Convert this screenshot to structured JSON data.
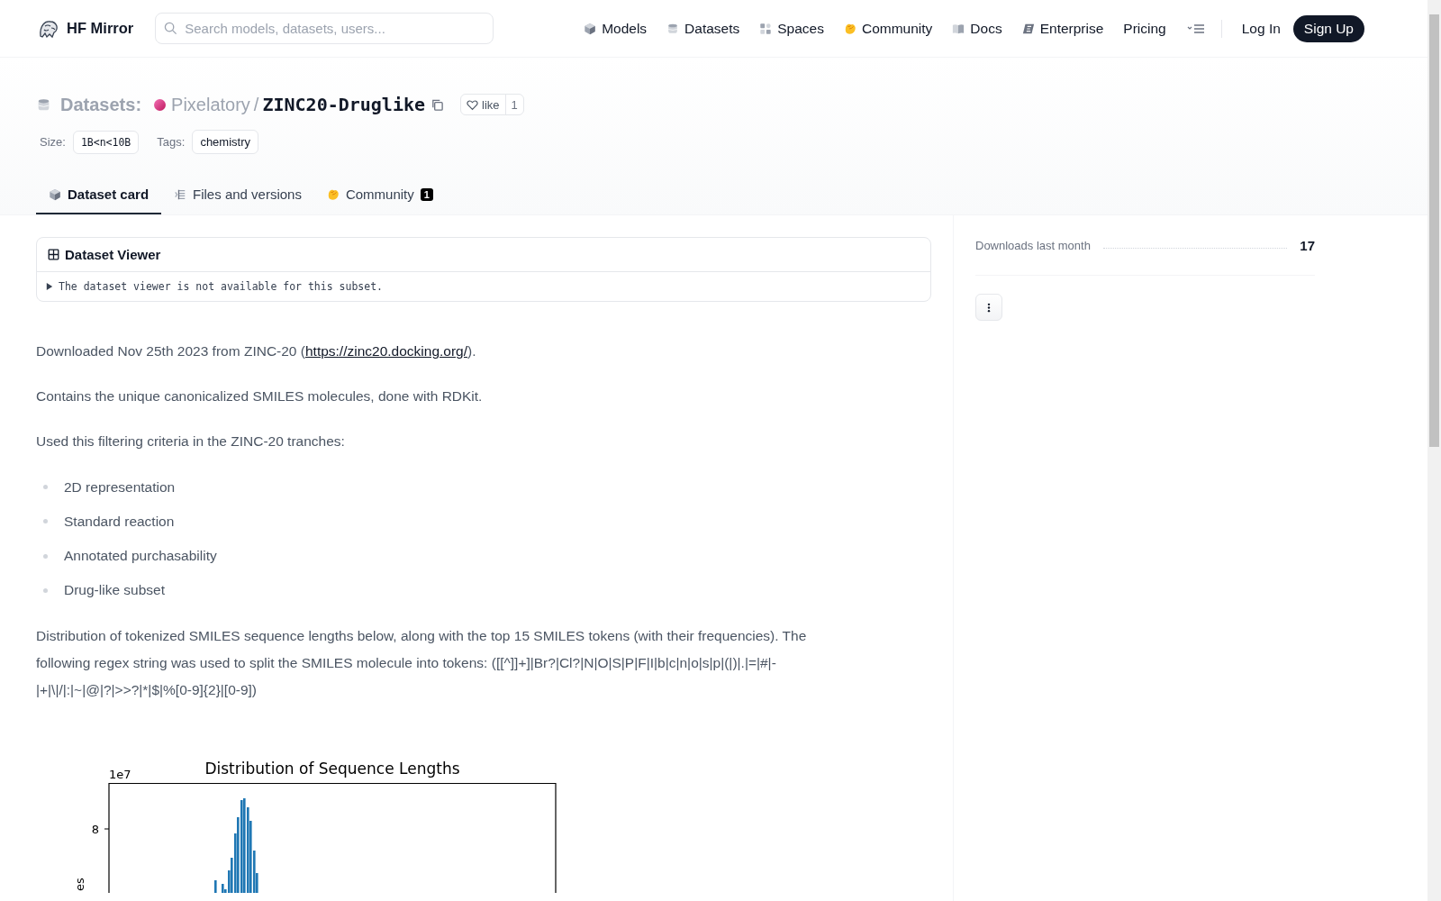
{
  "header": {
    "brand": "HF Mirror",
    "search": {
      "placeholder": "Search models, datasets, users..."
    },
    "nav": [
      {
        "label": "Models"
      },
      {
        "label": "Datasets"
      },
      {
        "label": "Spaces"
      },
      {
        "label": "Community"
      },
      {
        "label": "Docs"
      },
      {
        "label": "Enterprise"
      },
      {
        "label": "Pricing"
      }
    ],
    "login": "Log In",
    "signup": "Sign Up"
  },
  "repo": {
    "type_label": "Datasets:",
    "owner": "Pixelatory",
    "separator": "/",
    "name": "ZINC20-Druglike",
    "like": {
      "label": "like",
      "count": "1"
    },
    "size": {
      "label": "Size:",
      "value": "1B<n<10B"
    },
    "tags": {
      "label": "Tags:",
      "values": [
        "chemistry"
      ]
    }
  },
  "tabs": [
    {
      "label": "Dataset card",
      "selected": true
    },
    {
      "label": "Files and versions",
      "selected": false
    },
    {
      "label": "Community",
      "badge": "1",
      "selected": false
    }
  ],
  "viewer": {
    "title": "Dataset Viewer",
    "message": "The dataset viewer is not available for this subset."
  },
  "card": {
    "blocks": [
      {
        "kind": "paragraph",
        "parts": [
          {
            "kind": "text",
            "text": "Downloaded Nov 25th 2023 from ZINC-20 ("
          },
          {
            "kind": "link",
            "text": "https://zinc20.docking.org/"
          },
          {
            "kind": "text",
            "text": ")."
          }
        ]
      },
      {
        "kind": "paragraph",
        "parts": [
          {
            "kind": "text",
            "text": "Contains the unique canonicalized SMILES molecules, done with RDKit."
          }
        ]
      },
      {
        "kind": "paragraph",
        "parts": [
          {
            "kind": "text",
            "text": "Used this filtering criteria in the ZINC-20 tranches:"
          }
        ]
      },
      {
        "kind": "list",
        "items": [
          "2D representation",
          "Standard reaction",
          "Annotated purchasability",
          "Drug-like subset"
        ]
      },
      {
        "kind": "paragraph",
        "parts": [
          {
            "kind": "text",
            "text": "Distribution of tokenized SMILES sequence lengths below, along with the top 15 SMILES tokens (with their frequencies). The following regex string was used to split the SMILES molecule into tokens: ([[^]]+]|Br?|Cl?|N|O|S|P|F|I|b|c|n|o|s|p|(|)|.|=|#|-|+|\\|/|:|~|@|?|>>?|*|$|%[0-9]{2}|[0-9])"
          }
        ]
      }
    ],
    "chart": {
      "title": "Distribution of Sequence Lengths",
      "offset_label": "1e7",
      "ytick_labels": [
        "8"
      ],
      "ylabel": "es"
    }
  },
  "sidebar": {
    "downloads": {
      "label": "Downloads last month",
      "value": "17"
    }
  }
}
